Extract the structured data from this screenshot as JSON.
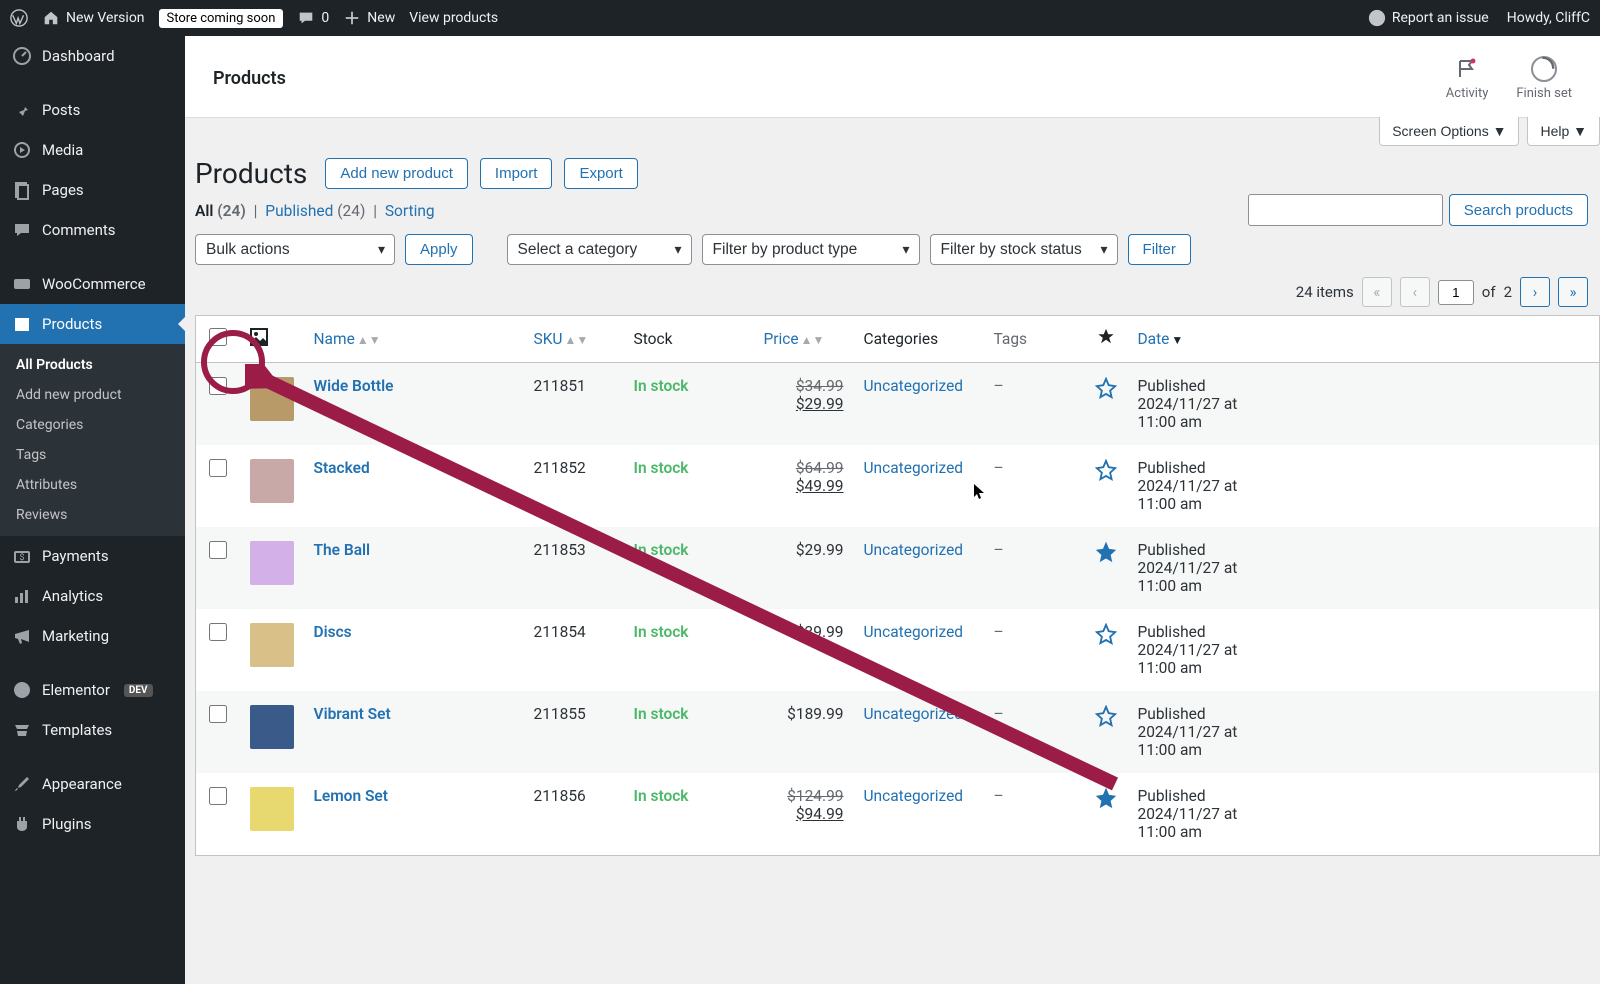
{
  "adminBar": {
    "siteName": "New Version",
    "storeBadge": "Store coming soon",
    "commentCount": "0",
    "newLabel": "New",
    "viewProducts": "View products",
    "reportIssue": "Report an issue",
    "howdy": "Howdy, CliffC"
  },
  "sidebar": {
    "items": [
      {
        "label": "Dashboard"
      },
      {
        "label": "Posts"
      },
      {
        "label": "Media"
      },
      {
        "label": "Pages"
      },
      {
        "label": "Comments"
      },
      {
        "label": "WooCommerce"
      },
      {
        "label": "Products"
      },
      {
        "label": "Payments"
      },
      {
        "label": "Analytics"
      },
      {
        "label": "Marketing"
      },
      {
        "label": "Elementor"
      },
      {
        "label": "Templates"
      },
      {
        "label": "Appearance"
      },
      {
        "label": "Plugins"
      }
    ],
    "submenu": [
      {
        "label": "All Products"
      },
      {
        "label": "Add new product"
      },
      {
        "label": "Categories"
      },
      {
        "label": "Tags"
      },
      {
        "label": "Attributes"
      },
      {
        "label": "Reviews"
      }
    ],
    "devBadge": "DEV"
  },
  "header": {
    "pageWhiteTitle": "Products",
    "activity": "Activity",
    "finishSetup": "Finish set",
    "screenOptions": "Screen Options",
    "help": "Help"
  },
  "titleArea": {
    "h1": "Products",
    "addNew": "Add new product",
    "import": "Import",
    "export": "Export"
  },
  "statusLinks": {
    "all": "All",
    "allCount": "(24)",
    "published": "Published",
    "publishedCount": "(24)",
    "sorting": "Sorting"
  },
  "filters": {
    "bulkActions": "Bulk actions",
    "apply": "Apply",
    "selectCategory": "Select a category",
    "filterProductType": "Filter by product type",
    "filterStockStatus": "Filter by stock status",
    "filterBtn": "Filter"
  },
  "search": {
    "button": "Search products"
  },
  "pagination": {
    "itemsLabel": "24 items",
    "currentPage": "1",
    "of": "of",
    "totalPages": "2"
  },
  "columns": {
    "name": "Name",
    "sku": "SKU",
    "stock": "Stock",
    "price": "Price",
    "categories": "Categories",
    "tags": "Tags",
    "date": "Date"
  },
  "rows": [
    {
      "name": "Wide Bottle",
      "sku": "211851",
      "stock": "In stock",
      "origPrice": "$34.99",
      "salePrice": "$29.99",
      "hasSale": true,
      "category": "Uncategorized",
      "tags": "–",
      "featured": false,
      "dateLine1": "Published",
      "dateLine2": "2024/11/27 at",
      "dateLine3": "11:00 am",
      "thumb": "#b89968"
    },
    {
      "name": "Stacked",
      "sku": "211852",
      "stock": "In stock",
      "origPrice": "$64.99",
      "salePrice": "$49.99",
      "hasSale": true,
      "category": "Uncategorized",
      "tags": "–",
      "featured": false,
      "dateLine1": "Published",
      "dateLine2": "2024/11/27 at",
      "dateLine3": "11:00 am",
      "thumb": "#c9a8a8"
    },
    {
      "name": "The Ball",
      "sku": "211853",
      "stock": "In stock",
      "origPrice": "$29.99",
      "salePrice": "",
      "hasSale": false,
      "category": "Uncategorized",
      "tags": "–",
      "featured": true,
      "dateLine1": "Published",
      "dateLine2": "2024/11/27 at",
      "dateLine3": "11:00 am",
      "thumb": "#d4b0e8"
    },
    {
      "name": "Discs",
      "sku": "211854",
      "stock": "In stock",
      "origPrice": "$39.99",
      "salePrice": "",
      "hasSale": false,
      "category": "Uncategorized",
      "tags": "–",
      "featured": false,
      "dateLine1": "Published",
      "dateLine2": "2024/11/27 at",
      "dateLine3": "11:00 am",
      "thumb": "#d9c088"
    },
    {
      "name": "Vibrant Set",
      "sku": "211855",
      "stock": "In stock",
      "origPrice": "$189.99",
      "salePrice": "",
      "hasSale": false,
      "category": "Uncategorized",
      "tags": "–",
      "featured": false,
      "dateLine1": "Published",
      "dateLine2": "2024/11/27 at",
      "dateLine3": "11:00 am",
      "thumb": "#3a5a8a"
    },
    {
      "name": "Lemon Set",
      "sku": "211856",
      "stock": "In stock",
      "origPrice": "$124.99",
      "salePrice": "$94.99",
      "hasSale": true,
      "category": "Uncategorized",
      "tags": "–",
      "featured": true,
      "dateLine1": "Published",
      "dateLine2": "2024/11/27 at",
      "dateLine3": "11:00 am",
      "thumb": "#e8d870"
    }
  ]
}
